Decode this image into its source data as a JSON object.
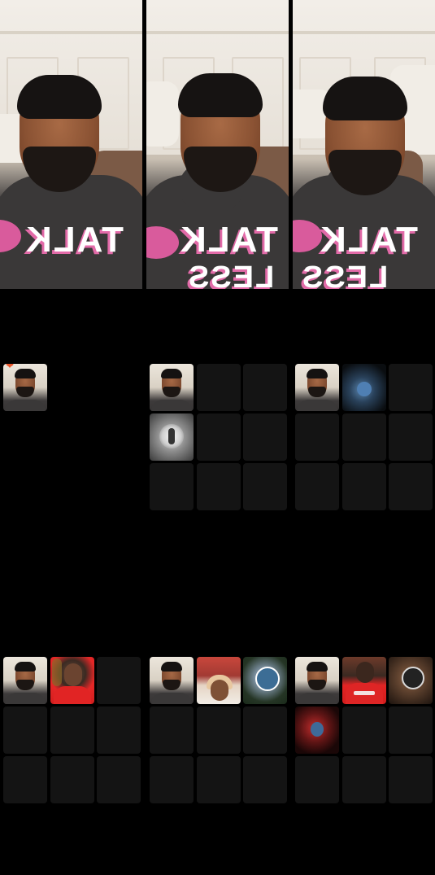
{
  "video_strip": {
    "feeds": [
      {
        "print_text": "TALK",
        "print_text_2": ""
      },
      {
        "print_text": "TALK",
        "print_text_2": "LESS"
      },
      {
        "print_text": "TALK",
        "print_text_2": "LESS"
      }
    ]
  },
  "grids": {
    "middle_row": [
      {
        "tiles": [
          "host-heart",
          "hidden",
          "hidden",
          "hidden",
          "hidden",
          "hidden",
          "hidden",
          "hidden",
          "hidden"
        ]
      },
      {
        "tiles": [
          "host",
          "empty",
          "empty",
          "gray-circle",
          "empty",
          "empty",
          "empty",
          "empty",
          "empty"
        ]
      },
      {
        "tiles": [
          "host",
          "dark-blue",
          "empty",
          "empty",
          "empty",
          "empty",
          "empty",
          "empty",
          "empty"
        ]
      }
    ],
    "bottom_row": [
      {
        "tiles": [
          "host",
          "red-man",
          "empty",
          "empty",
          "empty",
          "empty",
          "empty",
          "empty",
          "empty"
        ]
      },
      {
        "tiles": [
          "host",
          "woman",
          "green-round",
          "empty",
          "empty",
          "empty",
          "empty",
          "empty",
          "empty"
        ]
      },
      {
        "tiles": [
          "host",
          "man-red-shirt",
          "brown-round",
          "red-glow",
          "empty",
          "empty",
          "empty",
          "empty",
          "empty"
        ]
      }
    ]
  }
}
